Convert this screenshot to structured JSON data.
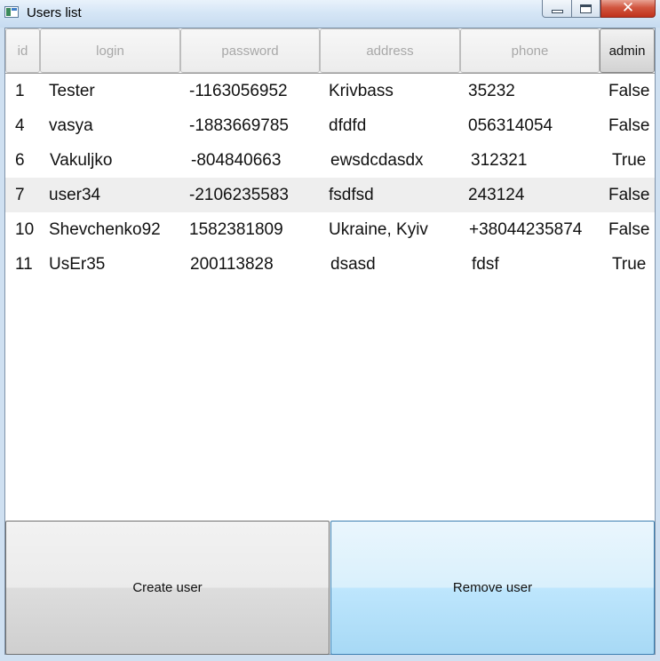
{
  "window": {
    "title": "Users list",
    "close_glyph": "✕"
  },
  "columns": [
    {
      "key": "id",
      "label": "id"
    },
    {
      "key": "login",
      "label": "login"
    },
    {
      "key": "password",
      "label": "password"
    },
    {
      "key": "address",
      "label": "address"
    },
    {
      "key": "phone",
      "label": "phone"
    },
    {
      "key": "admin",
      "label": "admin"
    }
  ],
  "sorted_column": "admin",
  "selected_row_index": 3,
  "rows": [
    {
      "id": "1",
      "login": "Tester",
      "password": "-1163056952",
      "address": "Krivbass",
      "phone": "35232",
      "admin": "False"
    },
    {
      "id": "4",
      "login": "vasya",
      "password": "-1883669785",
      "address": "dfdfd",
      "phone": "056314054",
      "admin": "False"
    },
    {
      "id": "6",
      "login": "Vakuljko",
      "password": "-804840663",
      "address": "ewsdcdasdx",
      "phone": "312321",
      "admin": "True"
    },
    {
      "id": "7",
      "login": "user34",
      "password": "-2106235583",
      "address": "fsdfsd",
      "phone": "243124",
      "admin": "False"
    },
    {
      "id": "10",
      "login": "Shevchenko92",
      "password": "1582381809",
      "address": "Ukraine, Kyiv",
      "phone": "+38044235874",
      "admin": "False"
    },
    {
      "id": "11",
      "login": "UsEr35",
      "password": "200113828",
      "address": "dsasd",
      "phone": "fdsf",
      "admin": "True"
    }
  ],
  "buttons": {
    "create_label": "Create user",
    "remove_label": "Remove user"
  },
  "colors": {
    "selected_row": "#eeeeee",
    "remove_button": "#bee6fd",
    "close_button": "#c0321d"
  }
}
